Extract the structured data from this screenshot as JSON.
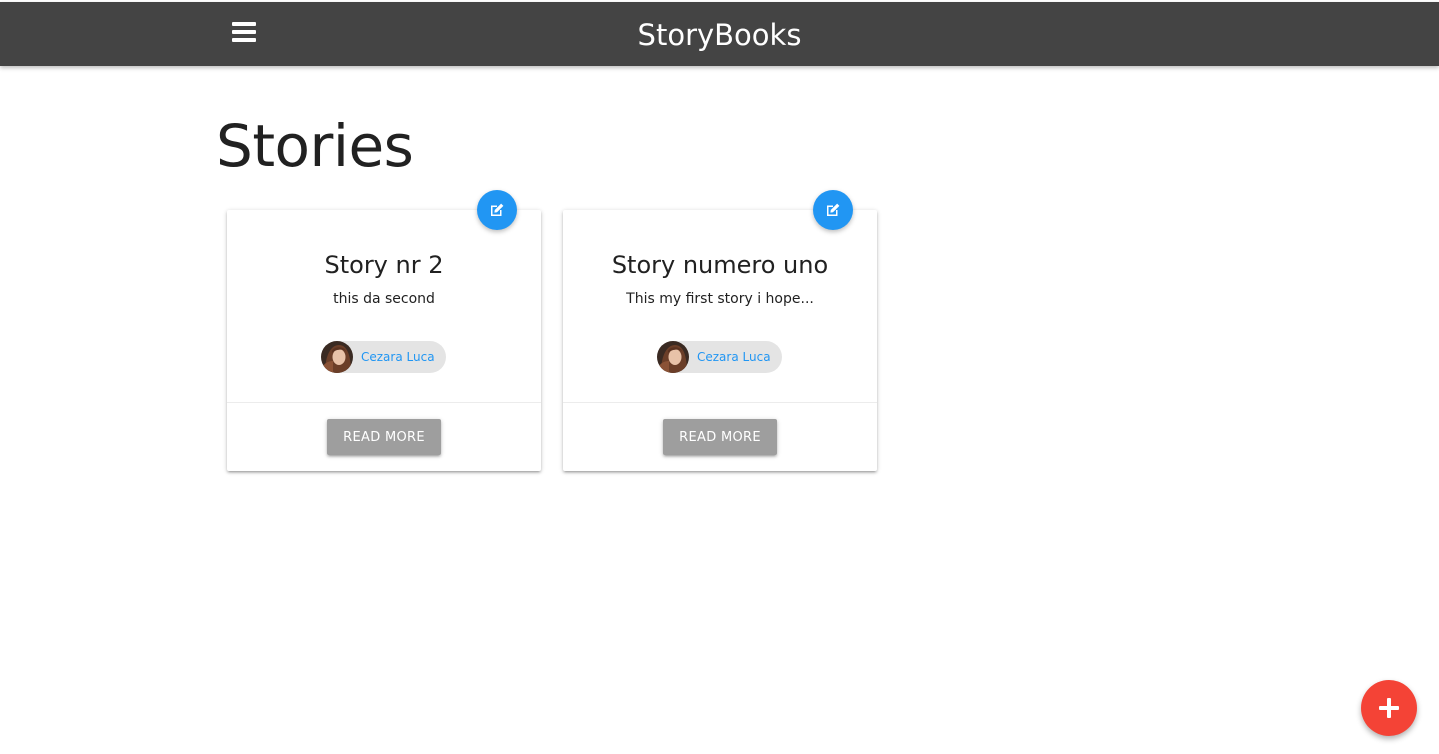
{
  "navbar": {
    "brand": "StoryBooks",
    "menu_icon": "hamburger-menu-icon"
  },
  "page": {
    "title": "Stories"
  },
  "stories": [
    {
      "title": "Story nr 2",
      "excerpt": "this da second",
      "author": "Cezara Luca",
      "action_label": "READ MORE",
      "edit_icon": "edit-icon"
    },
    {
      "title": "Story numero uno",
      "excerpt": "This my first story i hope...",
      "author": "Cezara Luca",
      "action_label": "READ MORE",
      "edit_icon": "edit-icon"
    }
  ],
  "fab": {
    "icon": "plus-icon"
  },
  "colors": {
    "navbar": "#444444",
    "accent_blue": "#2196f3",
    "fab_red": "#f44336",
    "button_grey": "#9e9e9e",
    "chip_bg": "#e4e4e4"
  }
}
